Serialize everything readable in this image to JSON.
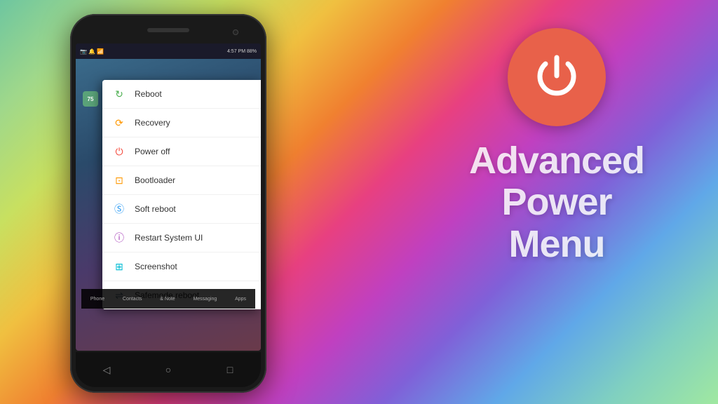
{
  "background": {
    "gradient_description": "colorful diagonal gradient green to pink to purple"
  },
  "phone": {
    "status_bar": {
      "left_items": "75 icons",
      "right_items": "4:57 PM  88%"
    },
    "badge": "75",
    "taskbar_items": [
      "Phone",
      "Contacts",
      "& Note",
      "Messaging",
      "Apps"
    ]
  },
  "power_menu": {
    "items": [
      {
        "label": "Reboot",
        "icon_color": "#4caf50",
        "icon_type": "reboot"
      },
      {
        "label": "Recovery",
        "icon_color": "#ff9800",
        "icon_type": "recovery"
      },
      {
        "label": "Power off",
        "icon_color": "#f44336",
        "icon_type": "power"
      },
      {
        "label": "Bootloader",
        "icon_color": "#ff9800",
        "icon_type": "bootloader"
      },
      {
        "label": "Soft reboot",
        "icon_color": "#2196f3",
        "icon_type": "soft-reboot"
      },
      {
        "label": "Restart System UI",
        "icon_color": "#9c27b0",
        "icon_type": "restart-ui"
      },
      {
        "label": "Screenshot",
        "icon_color": "#00bcd4",
        "icon_type": "screenshot"
      },
      {
        "label": "Safemode reboot",
        "icon_color": "#607d8b",
        "icon_type": "safemode"
      }
    ]
  },
  "nav_buttons": {
    "back": "◁",
    "home": "○",
    "recent": "□"
  },
  "right_panel": {
    "title_lines": [
      "Advanced",
      "Power",
      "Menu"
    ],
    "power_icon_label": "power-icon"
  }
}
